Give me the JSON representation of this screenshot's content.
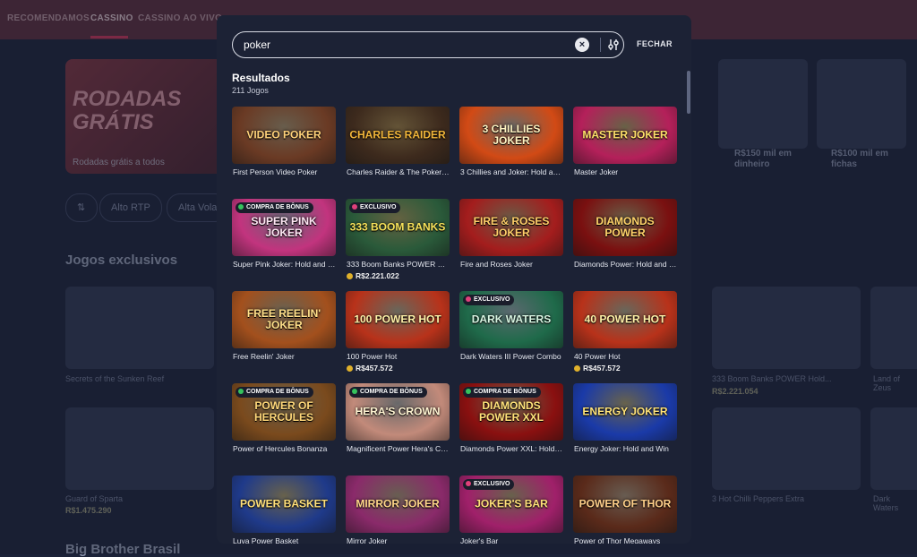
{
  "background": {
    "nav": [
      "RECOMENDAMOS",
      "CASSINO",
      "CASSINO AO VIVO"
    ],
    "banner": {
      "title": "RODADAS GRÁTIS",
      "subtitle": "Rodadas grátis a todos"
    },
    "pills": [
      "Alto RTP",
      "Alta Vola"
    ],
    "side_promos": [
      "R$150 mil em dinheiro",
      "R$100 mil em fichas"
    ],
    "section_exclusive": "Jogos exclusivos",
    "section_bbb": "Big Brother Brasil",
    "labels": [
      "Secrets of the Sunken Reef",
      "333 Boom Banks POWER Hold...",
      "Land of Zeus"
    ],
    "price_left": "R$2.221.054",
    "label_sparta": "Guard of Sparta",
    "price_sparta": "R$1.475.290",
    "label_chilli": "3 Hot Chilli Peppers Extra",
    "label_dark": "Dark Waters"
  },
  "search": {
    "value": "poker",
    "clear_icon": "×",
    "close_label": "FECHAR"
  },
  "results": {
    "title": "Resultados",
    "count": "211 Jogos",
    "games": [
      {
        "name": "First Person Video Poker",
        "thumb_text": "Video Poker",
        "bg": "#6a3a24",
        "fg": "#ffd27a"
      },
      {
        "name": "Charles Raider & The Poker Riches",
        "thumb_text": "Charles Raider",
        "bg": "#3d2a1d",
        "fg": "#f2b63a"
      },
      {
        "name": "3 Chillies and Joker: Hold and Win",
        "thumb_text": "3 Chillies Joker",
        "bg": "#d24a15",
        "fg": "#fff3c2"
      },
      {
        "name": "Master Joker",
        "thumb_text": "Master Joker",
        "bg": "#b4205a",
        "fg": "#ffe06a"
      },
      {
        "name": "Super Pink Joker: Hold and Win",
        "thumb_text": "Super Pink Joker",
        "bg": "#c2347e",
        "fg": "#ffe7f4",
        "badge": "COMPRA DE BÔNUS",
        "badge_color": "#36c25d"
      },
      {
        "name": "333 Boom Banks POWER Combo",
        "thumb_text": "333 Boom Banks",
        "bg": "#2a5a3a",
        "fg": "#f7e25a",
        "badge": "EXCLUSIVO",
        "badge_color": "#e0407a",
        "price": "R$2.221.022"
      },
      {
        "name": "Fire and Roses Joker",
        "thumb_text": "Fire & Roses Joker",
        "bg": "#a41d1d",
        "fg": "#ffcf6a"
      },
      {
        "name": "Diamonds Power: Hold and Win",
        "thumb_text": "Diamonds Power",
        "bg": "#7a1010",
        "fg": "#ffd36a"
      },
      {
        "name": "Free Reelin' Joker",
        "thumb_text": "Free Reelin' Joker",
        "bg": "#a3501d",
        "fg": "#ffe08a"
      },
      {
        "name": "100 Power Hot",
        "thumb_text": "100 Power Hot",
        "bg": "#b8321a",
        "fg": "#fff1a8",
        "price": "R$457.572"
      },
      {
        "name": "Dark Waters III Power Combo",
        "thumb_text": "Dark Waters",
        "bg": "#1f6a4a",
        "fg": "#d8f5e2",
        "badge": "EXCLUSIVO",
        "badge_color": "#e0407a"
      },
      {
        "name": "40 Power Hot",
        "thumb_text": "40 Power Hot",
        "bg": "#b8321a",
        "fg": "#fff1a8",
        "price": "R$457.572"
      },
      {
        "name": "Power of Hercules Bonanza",
        "thumb_text": "Power of Hercules",
        "bg": "#7a4a1d",
        "fg": "#ffd87a",
        "badge": "COMPRA DE BÔNUS",
        "badge_color": "#36c25d"
      },
      {
        "name": "Magnificent Power Hera's Crown",
        "thumb_text": "Hera's Crown",
        "bg": "#c28a7a",
        "fg": "#fff4d2",
        "badge": "COMPRA DE BÔNUS",
        "badge_color": "#36c25d"
      },
      {
        "name": "Diamonds Power XXL: Hold and Win",
        "thumb_text": "Diamonds Power XXL",
        "bg": "#8a1010",
        "fg": "#ffe27a",
        "badge": "COMPRA DE BÔNUS",
        "badge_color": "#36c25d"
      },
      {
        "name": "Energy Joker: Hold and Win",
        "thumb_text": "Energy Joker",
        "bg": "#1a3aa8",
        "fg": "#ffe37a"
      },
      {
        "name": "Luva Power Basket",
        "thumb_text": "Power Basket",
        "bg": "#1f3a8a",
        "fg": "#ffe07a"
      },
      {
        "name": "Mirror Joker",
        "thumb_text": "Mirror Joker",
        "bg": "#8a2a6a",
        "fg": "#ffd68a"
      },
      {
        "name": "Joker's Bar",
        "thumb_text": "Joker's Bar",
        "bg": "#a0206a",
        "fg": "#ffe07a",
        "badge": "EXCLUSIVO",
        "badge_color": "#e0407a"
      },
      {
        "name": "Power of Thor Megaways",
        "thumb_text": "Power of Thor",
        "bg": "#5a2a1a",
        "fg": "#ffd08a"
      }
    ]
  }
}
